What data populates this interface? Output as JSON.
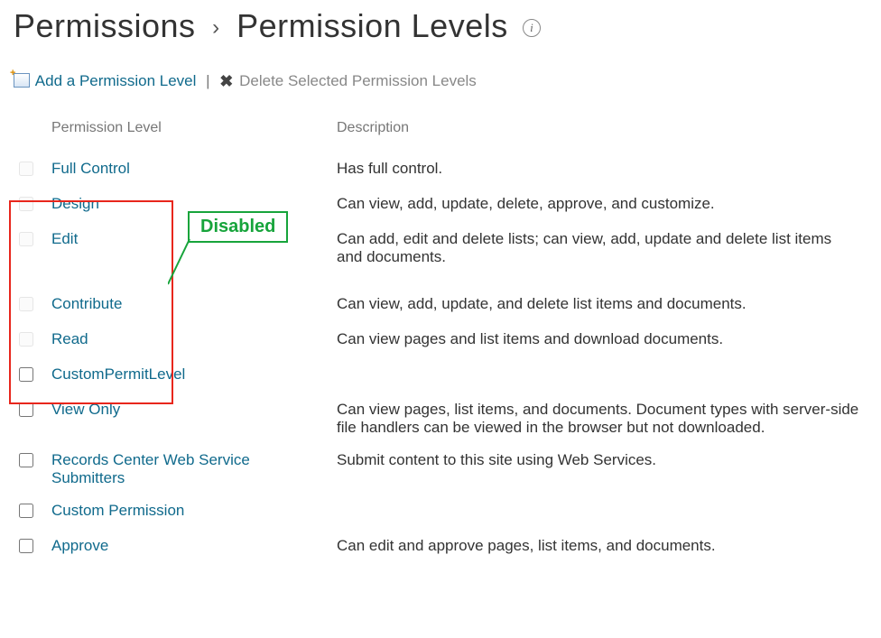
{
  "breadcrumb": {
    "parent": "Permissions",
    "current": "Permission Levels"
  },
  "toolbar": {
    "add_label": "Add a Permission Level",
    "delete_label": "Delete Selected Permission Levels"
  },
  "annotation": {
    "disabled_label": "Disabled"
  },
  "headers": {
    "level": "Permission Level",
    "desc": "Description"
  },
  "rows": [
    {
      "disabled": true,
      "name": "Full Control",
      "desc": "Has full control."
    },
    {
      "disabled": true,
      "name": "Design",
      "desc": "Can view, add, update, delete, approve, and customize."
    },
    {
      "disabled": true,
      "name": "Edit",
      "desc": "Can add, edit and delete lists; can view, add, update and delete list items and documents."
    },
    {
      "disabled": true,
      "name": "Contribute",
      "desc": "Can view, add, update, and delete list items and documents."
    },
    {
      "disabled": true,
      "name": "Read",
      "desc": "Can view pages and list items and download documents."
    },
    {
      "disabled": false,
      "name": "CustomPermitLevel",
      "desc": ""
    },
    {
      "disabled": false,
      "name": "View Only",
      "desc": "Can view pages, list items, and documents. Document types with server-side file handlers can be viewed in the browser but not downloaded."
    },
    {
      "disabled": false,
      "name": "Records Center Web Service Submitters",
      "desc": "Submit content to this site using Web Services."
    },
    {
      "disabled": false,
      "name": "Custom Permission",
      "desc": ""
    },
    {
      "disabled": false,
      "name": "Approve",
      "desc": "Can edit and approve pages, list items, and documents."
    }
  ]
}
